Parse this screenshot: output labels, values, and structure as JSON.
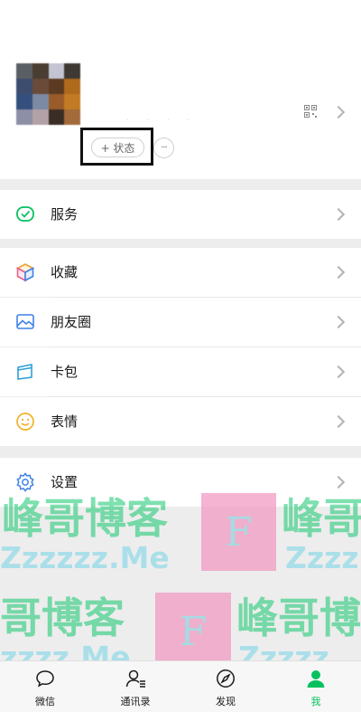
{
  "profile": {
    "status_label": "+ 状态",
    "more_label": "···"
  },
  "menu": {
    "services": "服务",
    "favorites": "收藏",
    "moments": "朋友圈",
    "cards": "卡包",
    "stickers": "表情",
    "settings": "设置"
  },
  "watermark": {
    "line1": "峰哥博客",
    "line2": "Zzzzzz.Me",
    "line3": "哥博客",
    "line4": "zzzz.Me",
    "right1": "峰哥",
    "right2": "Zzzz",
    "right3": "峰哥博",
    "right4": "Zzzzz",
    "box_letter": "F"
  },
  "tabbar": {
    "chats": "微信",
    "contacts": "通讯录",
    "discover": "发现",
    "me": "我"
  },
  "colors": {
    "accent": "#07c160",
    "background": "#ededed",
    "watermark_text": "#14c76e",
    "watermark_text_light": "#7fd7e8",
    "watermark_box": "#f29bc2"
  }
}
